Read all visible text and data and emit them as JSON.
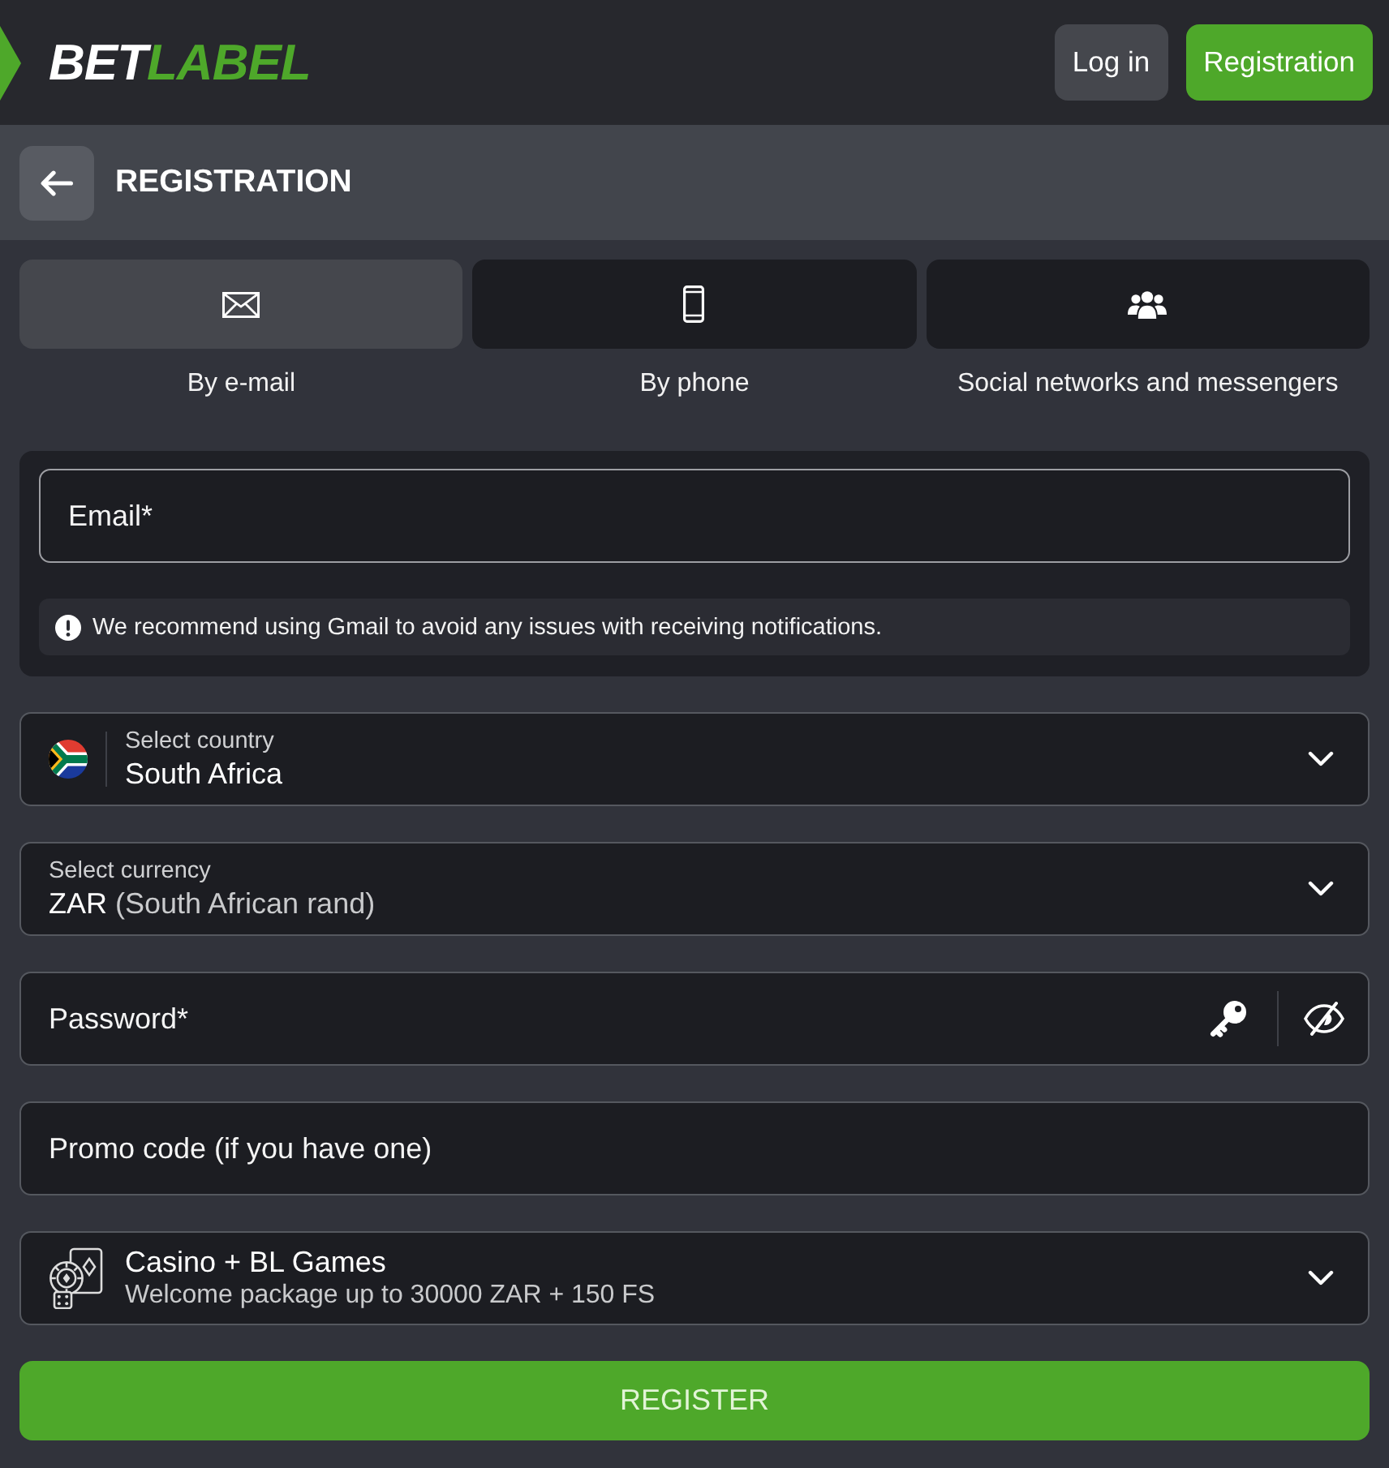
{
  "header": {
    "logo": {
      "text": "BET",
      "accent_text": "LABEL"
    },
    "buttons": [
      {
        "label": "Log in",
        "kind": "secondary"
      },
      {
        "label": "Registration",
        "kind": "primary"
      }
    ]
  },
  "title_bar": {
    "title": "REGISTRATION"
  },
  "method_tabs": [
    {
      "kind": "email",
      "label": "By e-mail",
      "selected": true
    },
    {
      "kind": "phone",
      "label": "By phone",
      "selected": false
    },
    {
      "kind": "social",
      "label": "Social networks and messengers",
      "selected": false
    }
  ],
  "email_card": {
    "field": {
      "placeholder": "Email*",
      "focused": true
    },
    "notice": "We recommend using Gmail to avoid any issues with receiving notifications."
  },
  "fields": [
    {
      "kind": "country",
      "label": "Select country",
      "value": "South Africa"
    },
    {
      "kind": "currency",
      "label": "Select currency",
      "value": "ZAR",
      "value_note": "(South African rand)"
    },
    {
      "kind": "password",
      "placeholder": "Password*"
    },
    {
      "kind": "promo",
      "placeholder": "Promo code (if you have one)"
    },
    {
      "kind": "bonus",
      "title": "Casino + BL Games",
      "subtitle": "Welcome package up to 30000 ZAR + 150 FS"
    }
  ],
  "submit_button": {
    "label": "REGISTER"
  }
}
